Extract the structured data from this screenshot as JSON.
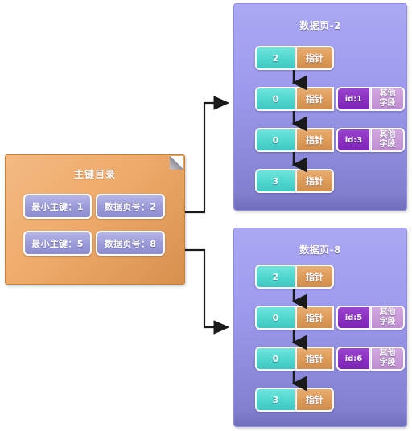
{
  "directory": {
    "title": "主键目录",
    "rows": [
      {
        "key_label": "最小主键：1",
        "page_label": "数据页号：2"
      },
      {
        "key_label": "最小主键：5",
        "page_label": "数据页号：8"
      }
    ]
  },
  "pages": [
    {
      "title": "数据页-2",
      "rows": [
        {
          "num": "2",
          "ptr": "指针"
        },
        {
          "num": "0",
          "ptr": "指针",
          "id": "id:1",
          "other_line1": "其他",
          "other_line2": "字段"
        },
        {
          "num": "0",
          "ptr": "指针",
          "id": "id:3",
          "other_line1": "其他",
          "other_line2": "字段"
        },
        {
          "num": "3",
          "ptr": "指针"
        }
      ]
    },
    {
      "title": "数据页-8",
      "rows": [
        {
          "num": "2",
          "ptr": "指针"
        },
        {
          "num": "0",
          "ptr": "指针",
          "id": "id:5",
          "other_line1": "其他",
          "other_line2": "字段"
        },
        {
          "num": "0",
          "ptr": "指针",
          "id": "id:6",
          "other_line1": "其他",
          "other_line2": "字段"
        },
        {
          "num": "3",
          "ptr": "指针"
        }
      ]
    }
  ],
  "colors": {
    "directory_card": "#eeab6b",
    "directory_cell": "#9a9ad8",
    "page_panel": "#9e9bee",
    "cell_num": "#4ed6cd",
    "cell_ptr": "#dd9a58",
    "cell_id": "#8a2fc2",
    "cell_other": "#c89ad8",
    "connector": "#1a1a1a"
  }
}
